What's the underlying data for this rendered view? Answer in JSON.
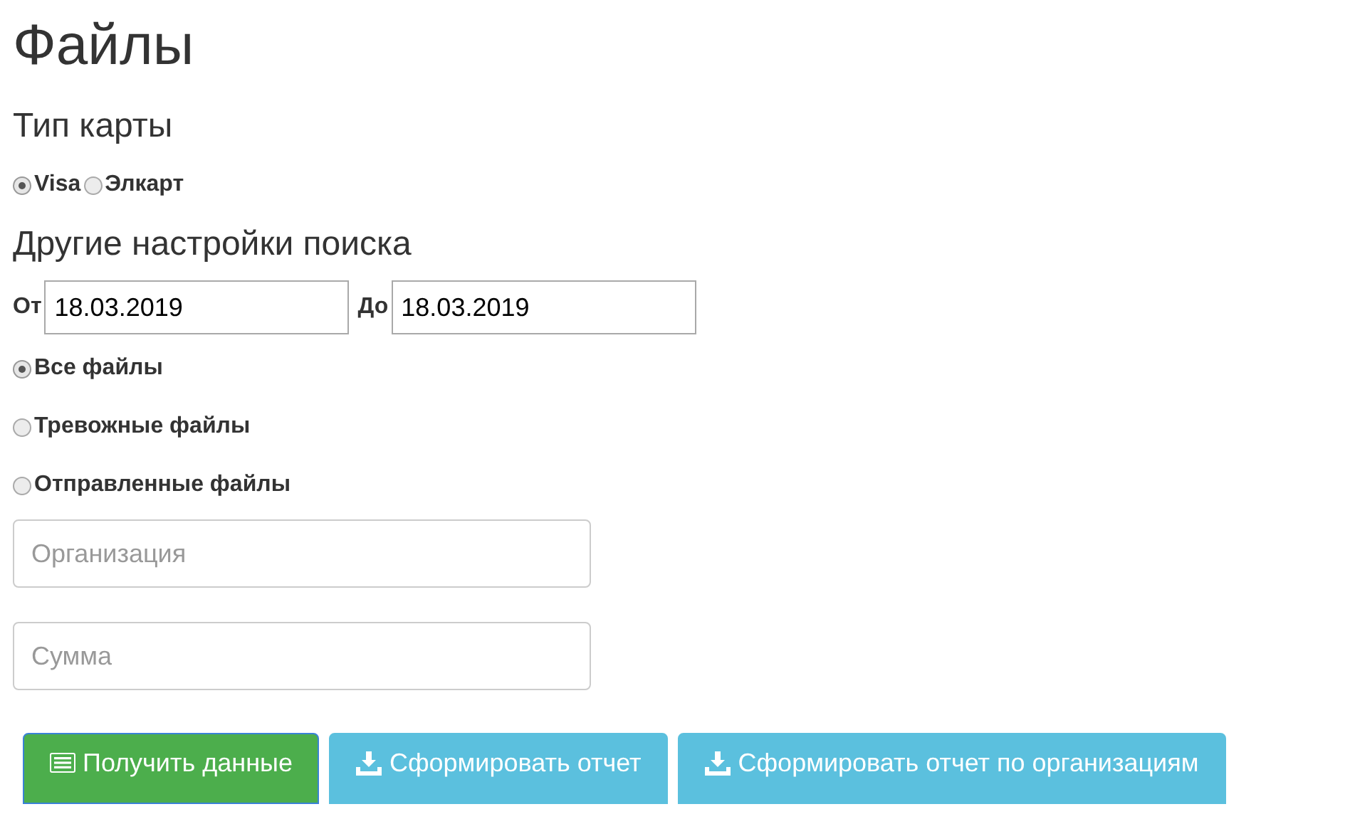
{
  "title": "Файлы",
  "card_type": {
    "heading": "Тип карты",
    "options": [
      {
        "label": "Visa",
        "selected": true
      },
      {
        "label": "Элкарт",
        "selected": false
      }
    ]
  },
  "search": {
    "heading": "Другие настройки поиска",
    "dates": [
      {
        "label": "От",
        "value": "18.03.2019"
      },
      {
        "label": "До",
        "value": "18.03.2019"
      }
    ],
    "file_filter": [
      {
        "label": "Все файлы",
        "selected": true
      },
      {
        "label": "Тревожные файлы",
        "selected": false
      },
      {
        "label": "Отправленные файлы",
        "selected": false
      }
    ],
    "fields": [
      {
        "placeholder": "Организация"
      },
      {
        "placeholder": "Сумма"
      }
    ]
  },
  "buttons": [
    {
      "label": "Получить данные",
      "kind": "primary"
    },
    {
      "label": "Сформировать отчет",
      "kind": "info"
    },
    {
      "label": "Сформировать отчет по организациям",
      "kind": "info"
    }
  ]
}
